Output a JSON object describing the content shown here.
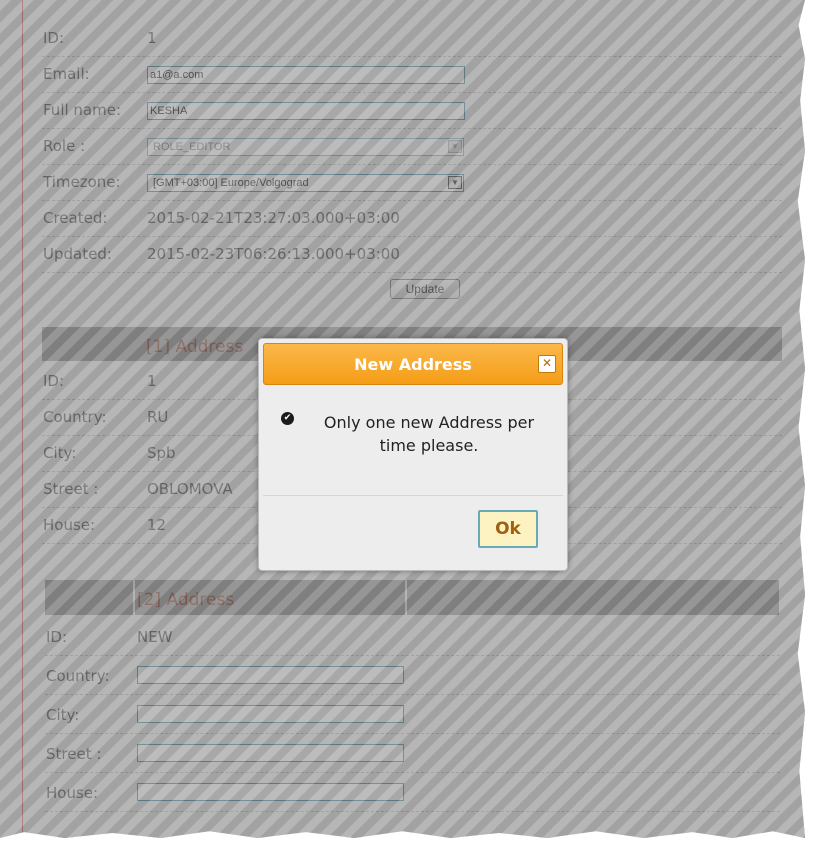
{
  "user": {
    "id_label": "ID:",
    "id_value": "1",
    "email_label": "Email:",
    "email_value": "a1@a.com",
    "fullname_label": "Full name:",
    "fullname_value": "KESHA",
    "role_label": "Role :",
    "role_value": "ROLE_EDITOR",
    "timezone_label": "Timezone:",
    "timezone_value": "[GMT+03:00] Europe/Volgograd",
    "created_label": "Created:",
    "created_value": "2015-02-21T23:27:03.000+03:00",
    "updated_label": "Updated:",
    "updated_value": "2015-02-23T06:26:13.000+03:00",
    "update_button": "Update"
  },
  "address1": {
    "header": "[1] Address",
    "id_label": "ID:",
    "id_value": "1",
    "country_label": "Country:",
    "country_value": "RU",
    "city_label": "City:",
    "city_value": "Spb",
    "street_label": "Street :",
    "street_value": "OBLOMOVA",
    "house_label": "House:",
    "house_value": "12"
  },
  "address2": {
    "header": "[2] Address",
    "id_label": "ID:",
    "id_value": "NEW",
    "country_label": "Country:",
    "country_value": "",
    "city_label": "City:",
    "city_value": "",
    "street_label": "Street :",
    "street_value": "",
    "house_label": "House:",
    "house_value": ""
  },
  "dialog": {
    "title": "New Address",
    "close_icon": "close-icon",
    "check_icon": "check-circle-icon",
    "message": "Only one new Address per time please.",
    "ok_label": "Ok"
  },
  "colors": {
    "dialog_header": "#f59d17",
    "section_header_text": "#8a3e2a",
    "input_border": "#4a8aa0"
  }
}
